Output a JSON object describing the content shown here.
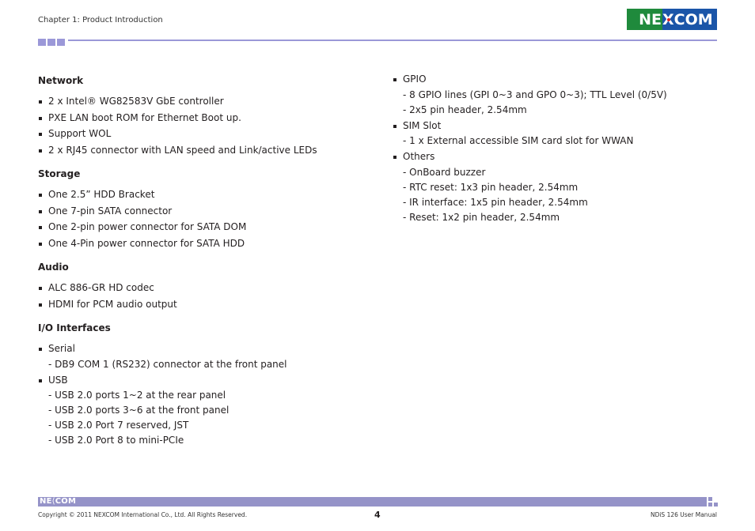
{
  "header": {
    "chapter": "Chapter 1: Product Introduction",
    "logo": {
      "left": "NE",
      "x": "X",
      "right": "COM",
      "green": "#1f8a3c",
      "blue": "#1a55a8",
      "accent": "#9b98d8"
    }
  },
  "left_column": [
    {
      "heading": "Network",
      "items": [
        {
          "label": "2 x Intel® WG82583V GbE controller",
          "subs": []
        },
        {
          "label": "PXE LAN boot ROM for Ethernet Boot up.",
          "subs": []
        },
        {
          "label": "Support WOL",
          "subs": []
        },
        {
          "label": "2 x RJ45 connector with LAN speed and Link/active LEDs",
          "subs": []
        }
      ]
    },
    {
      "heading": "Storage",
      "items": [
        {
          "label": "One 2.5” HDD Bracket",
          "subs": []
        },
        {
          "label": "One 7-pin SATA connector",
          "subs": []
        },
        {
          "label": "One 2-pin power connector for SATA DOM",
          "subs": []
        },
        {
          "label": "One 4-Pin power connector for SATA HDD",
          "subs": []
        }
      ]
    },
    {
      "heading": "Audio",
      "items": [
        {
          "label": "ALC 886-GR HD codec",
          "subs": []
        },
        {
          "label": "HDMI for PCM audio output",
          "subs": []
        }
      ]
    },
    {
      "heading": "I/O Interfaces",
      "items": [
        {
          "label": "Serial",
          "subs": [
            "- DB9 COM 1 (RS232) connector at the front panel"
          ]
        },
        {
          "label": "USB",
          "subs": [
            "- USB 2.0 ports 1~2 at the rear panel",
            "- USB 2.0 ports 3~6 at the front panel",
            "- USB 2.0 Port 7 reserved, JST",
            "- USB 2.0 Port 8 to mini-PCIe"
          ]
        }
      ]
    }
  ],
  "right_column": [
    {
      "heading": "",
      "items": [
        {
          "label": "GPIO",
          "subs": [
            "- 8 GPIO lines (GPI 0~3 and GPO 0~3); TTL Level (0/5V)",
            "- 2x5 pin header, 2.54mm"
          ]
        },
        {
          "label": "SIM Slot",
          "subs": [
            "- 1 x External accessible SIM card slot for WWAN"
          ]
        },
        {
          "label": "Others",
          "subs": [
            "- OnBoard buzzer",
            "- RTC reset: 1x3 pin header, 2.54mm",
            "- IR interface: 1x5 pin header, 2.54mm",
            "- Reset: 1x2 pin header, 2.54mm"
          ]
        }
      ]
    }
  ],
  "footer": {
    "logo": "NE COM",
    "copyright": "Copyright © 2011 NEXCOM International Co., Ltd. All Rights Reserved.",
    "page_number": "4",
    "manual": "NDiS 126 User Manual"
  }
}
